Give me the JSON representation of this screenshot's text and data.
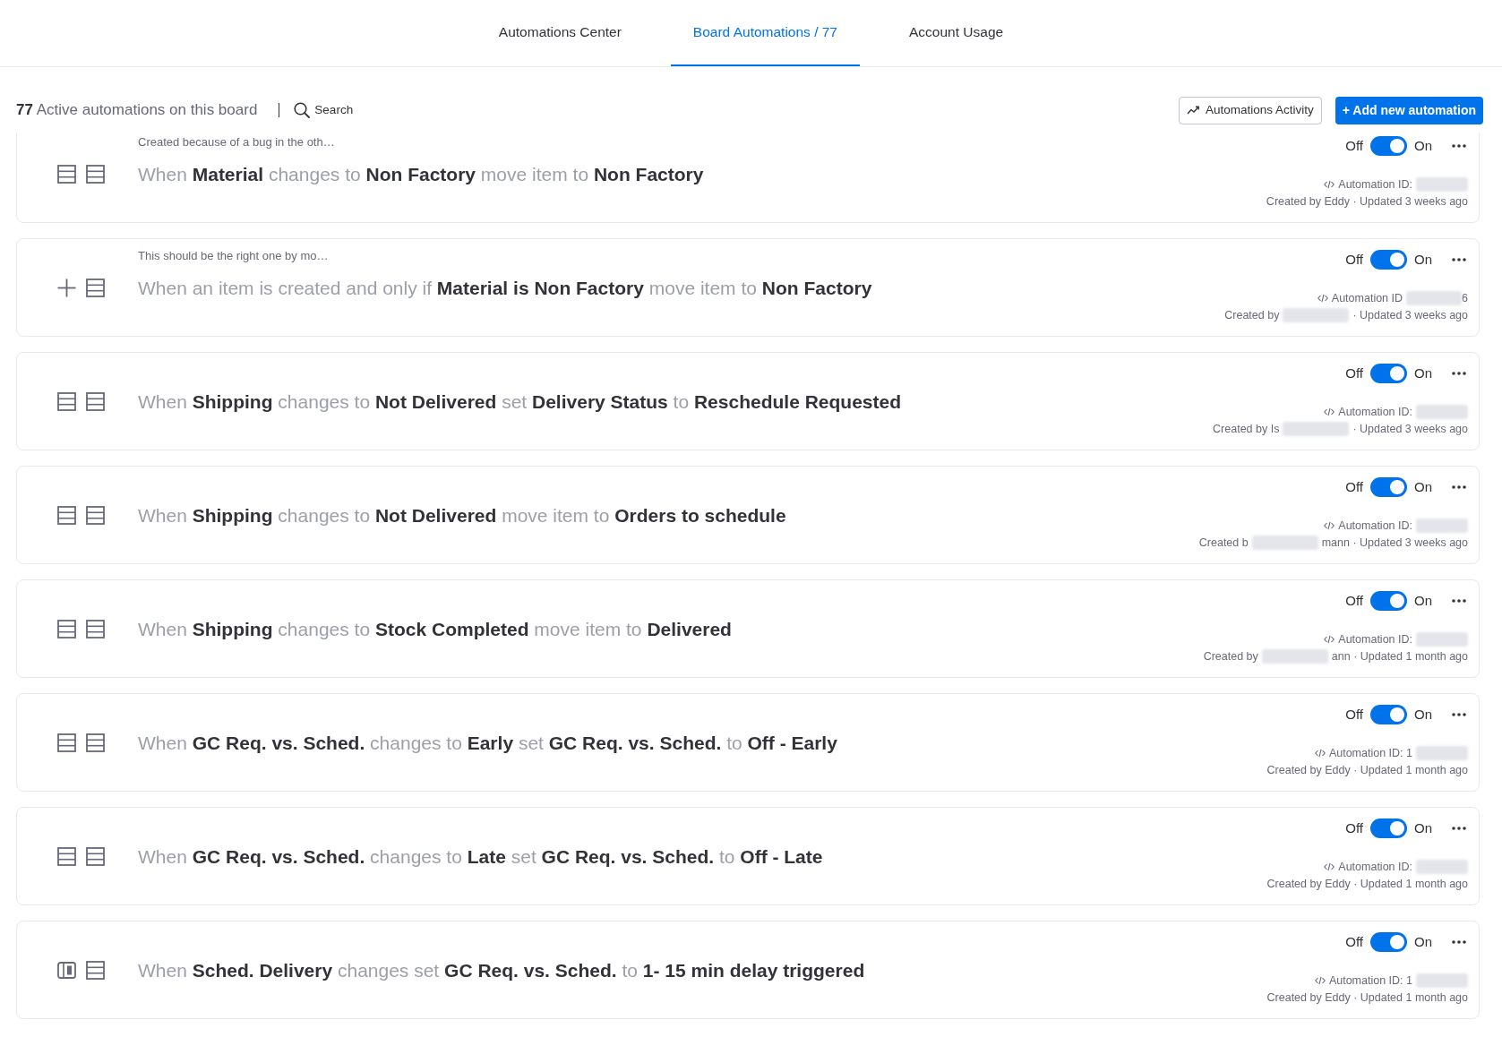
{
  "tabs": [
    {
      "label": "Automations Center",
      "selected": false
    },
    {
      "label": "Board Automations / 77",
      "selected": true
    },
    {
      "label": "Account Usage",
      "selected": false
    }
  ],
  "toolbar": {
    "summary": "**77** Active automations on this board",
    "search_label": "Search",
    "activity_button": "Automations Activity",
    "add_button": "+ Add new automation"
  },
  "automations": [
    {
      "note": "Created because of a bug in the oth…",
      "icons": [
        {
          "kind": "rows"
        },
        {
          "kind": "rows"
        }
      ],
      "sentence": "When **Material** changes to **Non Factory** move item to **Non Factory**",
      "off_label": "Off",
      "on_label": "On",
      "on": true,
      "id_label": "Automation ID:",
      "id_redacted": true,
      "created": "Created by Eddy · Updated 3 weeks ago"
    },
    {
      "note": "This should be the right one by mo…",
      "icons": [
        {
          "kind": "plus"
        },
        {
          "kind": "rows"
        }
      ],
      "sentence": "When an item is created and only if **Material is Non Factory** move item to **Non Factory**",
      "off_label": "Off",
      "on_label": "On",
      "on": true,
      "id_label": "Automation ID",
      "id_redacted": true,
      "id_tail": "6",
      "created": "Created by",
      "created_redacted": true,
      "created_tail": "· Updated 3 weeks ago"
    },
    {
      "icons": [
        {
          "kind": "rows"
        },
        {
          "kind": "rows"
        }
      ],
      "sentence": "When **Shipping** changes to **Not Delivered** set **Delivery Status** to **Reschedule Requested**",
      "off_label": "Off",
      "on_label": "On",
      "on": true,
      "id_label": "Automation ID:",
      "id_redacted": true,
      "created": "Created by Is",
      "created_redacted": true,
      "created_tail": "· Updated 3 weeks ago"
    },
    {
      "icons": [
        {
          "kind": "rows"
        },
        {
          "kind": "rows"
        }
      ],
      "sentence": "When **Shipping** changes to **Not Delivered** move item to **Orders to schedule**",
      "off_label": "Off",
      "on_label": "On",
      "on": true,
      "id_label": "Automation ID:",
      "id_redacted": true,
      "created": "Created b",
      "created_redacted": true,
      "created_tail": "mann · Updated 3 weeks ago"
    },
    {
      "icons": [
        {
          "kind": "rows"
        },
        {
          "kind": "rows"
        }
      ],
      "sentence": "When **Shipping** changes to **Stock Completed** move item to **Delivered**",
      "off_label": "Off",
      "on_label": "On",
      "on": true,
      "id_label": "Automation ID:",
      "id_redacted": true,
      "created": "Created by",
      "created_redacted": true,
      "created_tail": "ann · Updated 1 month ago"
    },
    {
      "icons": [
        {
          "kind": "rows"
        },
        {
          "kind": "rows"
        }
      ],
      "sentence": "When **GC Req. vs. Sched.** changes to **Early** set **GC Req. vs. Sched.** to **Off - Early**",
      "off_label": "Off",
      "on_label": "On",
      "on": true,
      "id_label": "Automation ID: 1",
      "id_redacted": true,
      "created": "Created by Eddy · Updated 1 month ago"
    },
    {
      "icons": [
        {
          "kind": "rows"
        },
        {
          "kind": "rows"
        }
      ],
      "sentence": "When **GC Req. vs. Sched.** changes to **Late** set **GC Req. vs. Sched.** to **Off - Late**",
      "off_label": "Off",
      "on_label": "On",
      "on": true,
      "id_label": "Automation ID:",
      "id_redacted": true,
      "created": "Created by Eddy · Updated 1 month ago"
    },
    {
      "icons": [
        {
          "kind": "panel"
        },
        {
          "kind": "rows"
        }
      ],
      "sentence": "When **Sched. Delivery** changes set **GC Req. vs. Sched.** to **1- 15 min delay triggered**",
      "off_label": "Off",
      "on_label": "On",
      "on": true,
      "id_label": "Automation ID: 1",
      "id_redacted": true,
      "created": "Created by Eddy · Updated 1 month ago"
    }
  ]
}
